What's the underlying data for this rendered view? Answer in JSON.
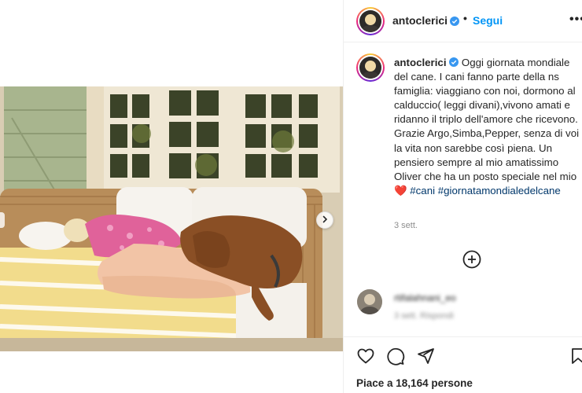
{
  "post": {
    "username": "antoclerici",
    "follow_label": "Segui",
    "separator": "•",
    "more_label": "•••",
    "caption": {
      "username": "antoclerici",
      "text": "Oggi giornata mondiale del cane. I cani fanno parte della ns famiglia: viaggiano con noi, dormono al calduccio( leggi divani),vivono amati e ridanno il triplo dell'amore che ricevono. Grazie Argo,Simba,Pepper, senza di voi la vita non sarebbe così piena. Un pensiero sempre al mio amatissimo Oliver che ha un posto speciale nel mio",
      "heart": "❤️",
      "hashtags": [
        "#cani",
        "#giornatamondialedelcane"
      ]
    },
    "time_ago": "3 sett.",
    "likes_text": "Piace a 18,164 persone",
    "comment": {
      "author_blurred": "rtifalahnani_eo",
      "text_blurred": "3 sett.  Rispondi"
    }
  },
  "icons": {
    "verified": "verified-badge-icon",
    "add_comment": "plus-circle-icon",
    "like": "heart-icon",
    "comment": "comment-icon",
    "share": "send-icon",
    "save": "bookmark-icon",
    "next": "chevron-right-icon"
  },
  "colors": {
    "accent_link": "#0095f6",
    "hashtag": "#00376b",
    "text": "#262626",
    "muted": "#8e8e8e",
    "heart": "#ed4956"
  }
}
